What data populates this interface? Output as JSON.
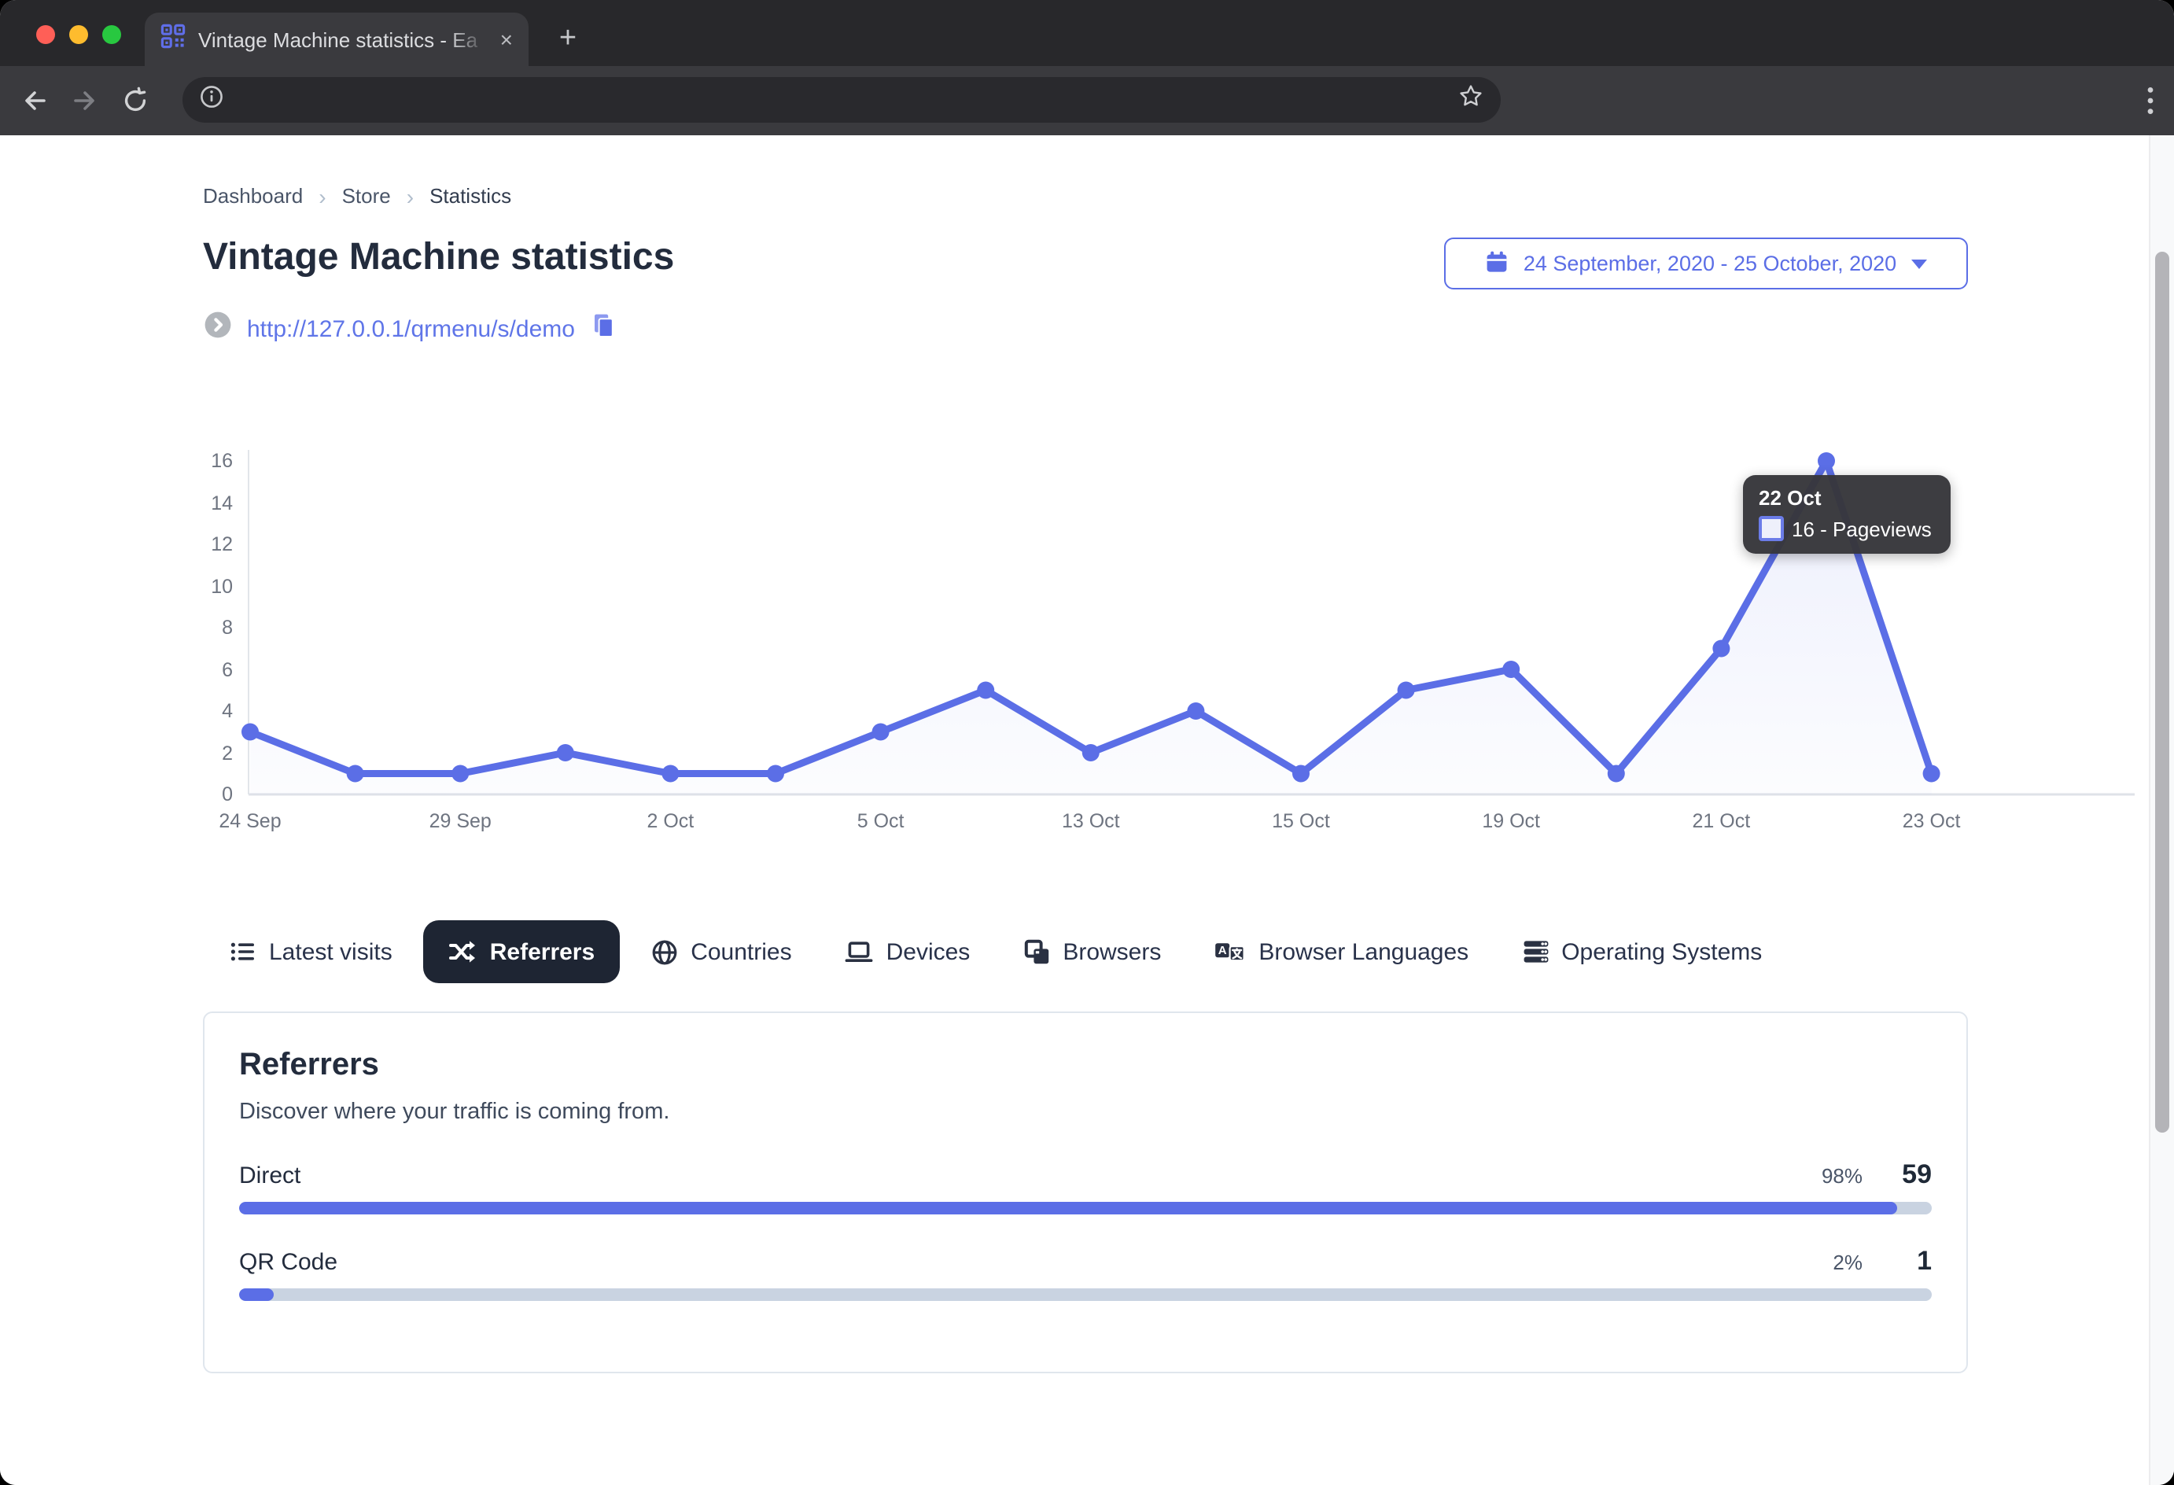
{
  "browser": {
    "tab_title": "Vintage Machine statistics - Ea",
    "close_glyph": "×",
    "new_tab_glyph": "+"
  },
  "breadcrumb": {
    "items": [
      "Dashboard",
      "Store",
      "Statistics"
    ]
  },
  "page": {
    "title": "Vintage Machine statistics",
    "url": "http://127.0.0.1/qrmenu/s/demo"
  },
  "date_range": {
    "label": "24 September, 2020 - 25 October, 2020"
  },
  "chart_data": {
    "type": "line",
    "series": [
      {
        "name": "Pageviews",
        "values": [
          3,
          1,
          1,
          2,
          1,
          1,
          3,
          5,
          2,
          4,
          1,
          5,
          6,
          1,
          7,
          16,
          1
        ]
      }
    ],
    "n_points": 17,
    "x_tick_labels": [
      "24 Sep",
      "29 Sep",
      "2 Oct",
      "5 Oct",
      "13 Oct",
      "15 Oct",
      "19 Oct",
      "21 Oct",
      "23 Oct"
    ],
    "x_tick_every": 2,
    "y_ticks": [
      0,
      2,
      4,
      6,
      8,
      10,
      12,
      14,
      16
    ],
    "ylim": [
      0,
      16
    ],
    "grid": false,
    "line_color": "#5b6ee6",
    "tooltip": {
      "date": "22 Oct",
      "value_label": "16 - Pageviews",
      "point_index": 15
    }
  },
  "tabs": [
    {
      "label": "Latest visits",
      "icon": "list-icon",
      "active": false
    },
    {
      "label": "Referrers",
      "icon": "shuffle-icon",
      "active": true
    },
    {
      "label": "Countries",
      "icon": "globe-icon",
      "active": false
    },
    {
      "label": "Devices",
      "icon": "laptop-icon",
      "active": false
    },
    {
      "label": "Browsers",
      "icon": "browser-windows-icon",
      "active": false
    },
    {
      "label": "Browser Languages",
      "icon": "translate-icon",
      "active": false
    },
    {
      "label": "Operating Systems",
      "icon": "server-stack-icon",
      "active": false
    }
  ],
  "referrers_card": {
    "title": "Referrers",
    "subtitle": "Discover where your traffic is coming from.",
    "rows": [
      {
        "label": "Direct",
        "percent": "98%",
        "count": "59",
        "fraction": 0.98
      },
      {
        "label": "QR Code",
        "percent": "2%",
        "count": "1",
        "fraction": 0.02
      }
    ]
  },
  "colors": {
    "accent": "#5b6ee6",
    "dark_navy": "#232c3d",
    "active_tab_bg": "#1e2533",
    "bar_track": "#c9d3e1",
    "tooltip_bg": "#38383c"
  }
}
